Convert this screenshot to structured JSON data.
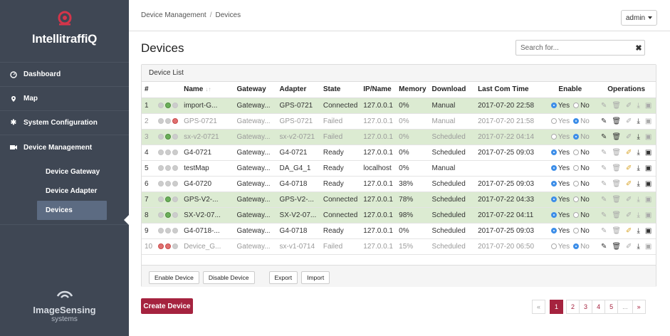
{
  "brand": {
    "name": "IntellitraffiQ",
    "accent": "#d3354a"
  },
  "sidebar": {
    "items": [
      {
        "label": "Dashboard",
        "icon": "dashboard-icon"
      },
      {
        "label": "Map",
        "icon": "map-pin-icon"
      },
      {
        "label": "System Configuration",
        "icon": "gear-icon"
      },
      {
        "label": "Device Management",
        "icon": "video-camera-icon"
      }
    ],
    "subitems": [
      {
        "label": "Device Gateway"
      },
      {
        "label": "Device Adapter"
      },
      {
        "label": "Devices",
        "active": true
      }
    ],
    "footer_brand": {
      "main": "ImageSensing",
      "sub": "systems"
    }
  },
  "topbar": {
    "breadcrumb": [
      "Device Management",
      "Devices"
    ],
    "user": "admin"
  },
  "page": {
    "title": "Devices",
    "search_placeholder": "Search for...",
    "panel_title": "Device List"
  },
  "table": {
    "columns": [
      "#",
      "Name",
      "Gateway",
      "Adapter",
      "State",
      "IP/Name",
      "Memory",
      "Download",
      "Last Com Time",
      "Enable",
      "Operations"
    ],
    "rows": [
      {
        "n": "1",
        "status": [
          "half",
          "on",
          "half"
        ],
        "name": "import-G...",
        "gateway": "Gateway...",
        "adapter": "GPS-0721",
        "state": "Connected",
        "ip": "127.0.0.1",
        "memory": "0%",
        "download": "Manual",
        "time": "2017-07-20 22:58",
        "enabled": "yes",
        "style": "green"
      },
      {
        "n": "2",
        "status": [
          "half",
          "half",
          "off"
        ],
        "name": "GPS-0721",
        "gateway": "Gateway...",
        "adapter": "GPS-0721",
        "state": "Failed",
        "ip": "127.0.0.1",
        "memory": "0%",
        "download": "Manual",
        "time": "2017-07-20 21:58",
        "enabled": "no",
        "style": "grey"
      },
      {
        "n": "3",
        "status": [
          "half",
          "on",
          "half"
        ],
        "name": "sx-v2-0721",
        "gateway": "Gateway...",
        "adapter": "sx-v2-0721",
        "state": "Failed",
        "ip": "127.0.0.1",
        "memory": "0%",
        "download": "Scheduled",
        "time": "2017-07-22 04:14",
        "enabled": "no",
        "style": "green grey"
      },
      {
        "n": "4",
        "status": [
          "half",
          "half",
          "half"
        ],
        "name": "G4-0721",
        "gateway": "Gateway...",
        "adapter": "G4-0721",
        "state": "Ready",
        "ip": "127.0.0.1",
        "memory": "0%",
        "download": "Scheduled",
        "time": "2017-07-25 09:03",
        "enabled": "yes",
        "style": ""
      },
      {
        "n": "5",
        "status": [
          "half",
          "half",
          "half"
        ],
        "name": "testMap",
        "gateway": "Gateway...",
        "adapter": "DA_G4_1",
        "state": "Ready",
        "ip": "localhost",
        "memory": "0%",
        "download": "Manual",
        "time": "",
        "enabled": "yes",
        "style": ""
      },
      {
        "n": "6",
        "status": [
          "half",
          "half",
          "half"
        ],
        "name": "G4-0720",
        "gateway": "Gateway...",
        "adapter": "G4-0718",
        "state": "Ready",
        "ip": "127.0.0.1",
        "memory": "38%",
        "download": "Scheduled",
        "time": "2017-07-25 09:03",
        "enabled": "yes",
        "style": ""
      },
      {
        "n": "7",
        "status": [
          "half",
          "on",
          "half"
        ],
        "name": "GPS-V2-...",
        "gateway": "Gateway...",
        "adapter": "GPS-V2-...",
        "state": "Connected",
        "ip": "127.0.0.1",
        "memory": "78%",
        "download": "Scheduled",
        "time": "2017-07-22 04:33",
        "enabled": "yes",
        "style": "green"
      },
      {
        "n": "8",
        "status": [
          "half",
          "on",
          "half"
        ],
        "name": "SX-V2-07...",
        "gateway": "Gateway...",
        "adapter": "SX-V2-07...",
        "state": "Connected",
        "ip": "127.0.0.1",
        "memory": "98%",
        "download": "Scheduled",
        "time": "2017-07-22 04:11",
        "enabled": "yes",
        "style": "green"
      },
      {
        "n": "9",
        "status": [
          "half",
          "half",
          "half"
        ],
        "name": "G4-0718-...",
        "gateway": "Gateway...",
        "adapter": "G4-0718",
        "state": "Ready",
        "ip": "127.0.0.1",
        "memory": "0%",
        "download": "Scheduled",
        "time": "2017-07-25 09:03",
        "enabled": "yes",
        "style": ""
      },
      {
        "n": "10",
        "status": [
          "off",
          "off",
          "half"
        ],
        "name": "Device_G...",
        "gateway": "Gateway...",
        "adapter": "sx-v1-0714",
        "state": "Failed",
        "ip": "127.0.0.1",
        "memory": "15%",
        "download": "Scheduled",
        "time": "2017-07-20 06:50",
        "enabled": "no",
        "style": "grey"
      }
    ],
    "enable_labels": {
      "yes": "Yes",
      "no": "No"
    }
  },
  "footer_buttons": {
    "enable": "Enable Device",
    "disable": "Disable Device",
    "export": "Export",
    "import": "Import"
  },
  "create_label": "Create Device",
  "pager": [
    "«",
    "1",
    "2",
    "3",
    "4",
    "5",
    "...",
    "»"
  ]
}
